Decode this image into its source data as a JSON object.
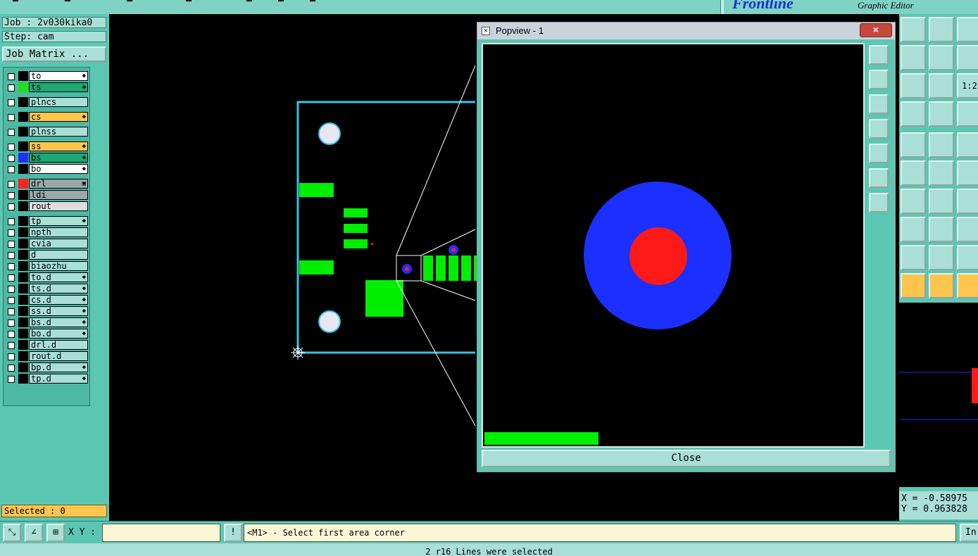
{
  "app": {
    "brand": "Frontline",
    "subtitle": "Graphic Editor"
  },
  "job": {
    "job_label": "Job : 2v030kika0",
    "step_label": "Step: cam",
    "matrix_button": "Job Matrix ..."
  },
  "layers": [
    {
      "name": "to",
      "swatch": "#000000",
      "bg": "#ffffff",
      "flag": "◆"
    },
    {
      "name": "ts",
      "swatch": "#22dd22",
      "bg": "#1ea872",
      "flag": "◆"
    },
    {
      "name": "plncs",
      "swatch": "#000000",
      "bg": "#a9dfd5",
      "flag": ""
    },
    {
      "name": "cs",
      "swatch": "#000000",
      "bg": "#ffc54d",
      "flag": "◆"
    },
    {
      "name": "plnss",
      "swatch": "#000000",
      "bg": "#a9dfd5",
      "flag": ""
    },
    {
      "name": "ss",
      "swatch": "#000000",
      "bg": "#ffc54d",
      "flag": "◆"
    },
    {
      "name": "bs",
      "swatch": "#1b2fff",
      "bg": "#1ea872",
      "flag": "◆"
    },
    {
      "name": "bo",
      "swatch": "#000000",
      "bg": "#ffffff",
      "flag": "◆"
    },
    {
      "name": "drl",
      "swatch": "#ff2222",
      "bg": "#9aa7ab",
      "flag": "▣"
    },
    {
      "name": "ldi",
      "swatch": "#000000",
      "bg": "#9aa7ab",
      "flag": ""
    },
    {
      "name": "rout",
      "swatch": "#000000",
      "bg": "#dedede",
      "flag": ""
    },
    {
      "name": "tp",
      "swatch": "#000000",
      "bg": "#a9dfd5",
      "flag": "◆"
    },
    {
      "name": "npth",
      "swatch": "#000000",
      "bg": "#a9dfd5",
      "flag": ""
    },
    {
      "name": "cvia",
      "swatch": "#000000",
      "bg": "#a9dfd5",
      "flag": ""
    },
    {
      "name": "d",
      "swatch": "#000000",
      "bg": "#a9dfd5",
      "flag": ""
    },
    {
      "name": "biaozhu",
      "swatch": "#000000",
      "bg": "#a9dfd5",
      "flag": ""
    },
    {
      "name": "to.d",
      "swatch": "#000000",
      "bg": "#a9dfd5",
      "flag": "◆"
    },
    {
      "name": "ts.d",
      "swatch": "#000000",
      "bg": "#a9dfd5",
      "flag": "◆"
    },
    {
      "name": "cs.d",
      "swatch": "#000000",
      "bg": "#a9dfd5",
      "flag": "◆"
    },
    {
      "name": "ss.d",
      "swatch": "#000000",
      "bg": "#a9dfd5",
      "flag": "◆"
    },
    {
      "name": "bs.d",
      "swatch": "#000000",
      "bg": "#a9dfd5",
      "flag": "◆"
    },
    {
      "name": "bo.d",
      "swatch": "#000000",
      "bg": "#a9dfd5",
      "flag": "◆"
    },
    {
      "name": "drl.d",
      "swatch": "#000000",
      "bg": "#a9dfd5",
      "flag": ""
    },
    {
      "name": "rout.d",
      "swatch": "#000000",
      "bg": "#a9dfd5",
      "flag": ""
    },
    {
      "name": "bp.d",
      "swatch": "#000000",
      "bg": "#a9dfd5",
      "flag": "◆"
    },
    {
      "name": "tp.d",
      "swatch": "#000000",
      "bg": "#a9dfd5",
      "flag": "◆"
    }
  ],
  "selected_label": "Selected : 0",
  "popview": {
    "title": "Popview - 1",
    "close_x": "×",
    "close_button": "Close"
  },
  "right_tools": {
    "scale_label": "1:2"
  },
  "coords": {
    "x": "X = -0.58975",
    "y": "Y = 0.963828"
  },
  "bottom": {
    "xy_label": "X Y :",
    "xy_value": "",
    "warn_glyph": "!",
    "prompt": "<M1> - Select first area corner",
    "in_button": "In"
  },
  "status": "2 r16 Lines were selected",
  "colors": {
    "panel": "#5bc7b2",
    "button": "#a9dfd5",
    "pad_green": "#00ee00",
    "outline_cyan": "#33c3e6",
    "via_blue": "#1b2fff",
    "drill_red": "#ff1a1a"
  }
}
